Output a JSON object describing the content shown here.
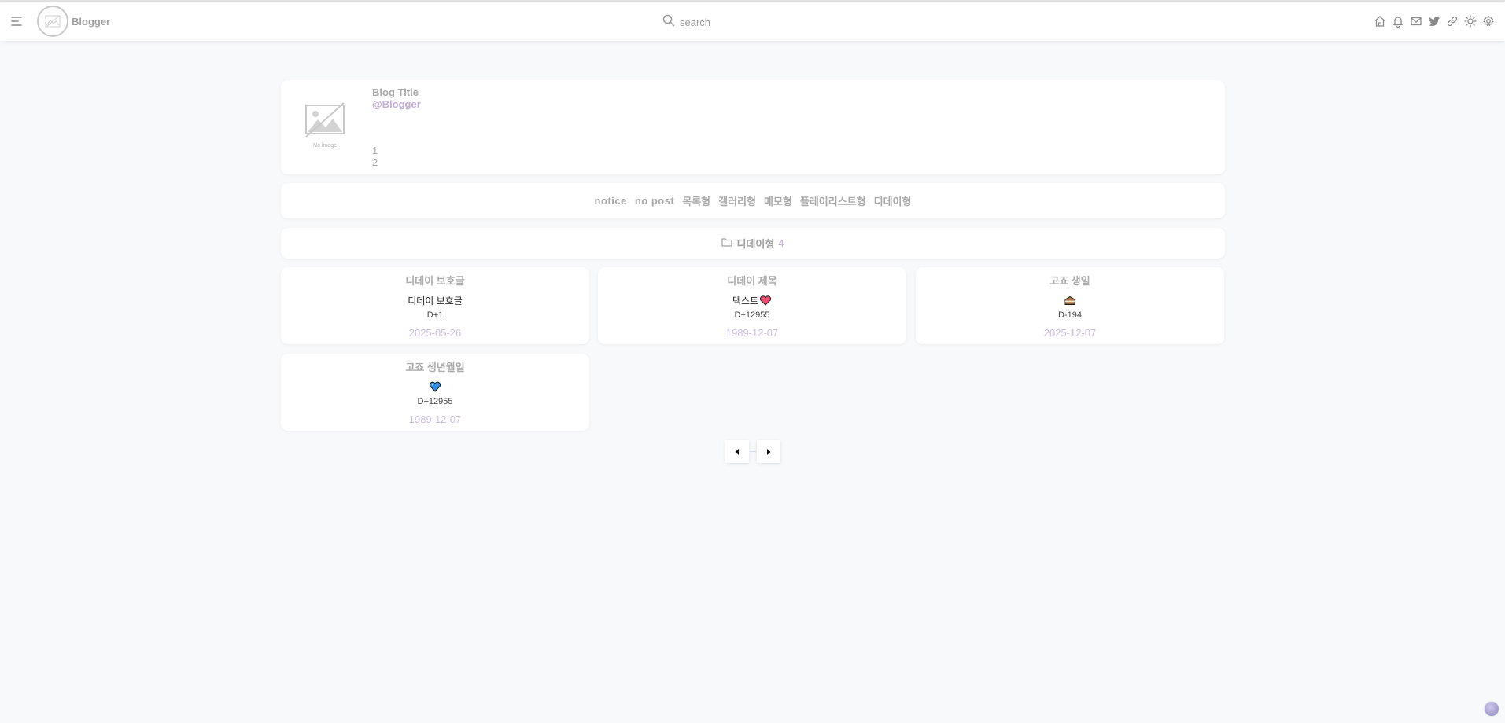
{
  "header": {
    "brand": "Blogger",
    "search_placeholder": "search",
    "icons": [
      "menu-icon",
      "home-icon",
      "bell-icon",
      "mail-icon",
      "twitter-icon",
      "link-icon",
      "sun-icon",
      "gear-icon"
    ]
  },
  "profile": {
    "title": "Blog Title",
    "handle": "@Blogger",
    "no_image_label": "No image",
    "stats": [
      "1",
      "2"
    ]
  },
  "categories": [
    "notice",
    "no post",
    "목록형",
    "갤러리형",
    "메모형",
    "플레이리스트형",
    "디데이형"
  ],
  "category_header": {
    "name": "디데이형",
    "count": "4",
    "icon": "folder-icon"
  },
  "posts": [
    {
      "title": "디데이 보호글",
      "content": "디데이 보호글",
      "emoji": "",
      "dday": "D+1",
      "date": "2025-05-26"
    },
    {
      "title": "디데이 제목",
      "content": "텍스트",
      "emoji": "heart-pink-icon",
      "dday": "D+12955",
      "date": "1989-12-07"
    },
    {
      "title": "고죠 생일",
      "content": "",
      "emoji": "cake-icon",
      "dday": "D-194",
      "date": "2025-12-07"
    },
    {
      "title": "고죠 생년월일",
      "content": "",
      "emoji": "heart-blue-icon",
      "dday": "D+12955",
      "date": "1989-12-07"
    }
  ],
  "pagination": {
    "prev_icon": "caret-left-icon",
    "next_icon": "caret-right-icon"
  },
  "colors": {
    "accent": "#c2aed8",
    "date": "#cbbfe0",
    "background": "#f8f9fb"
  }
}
